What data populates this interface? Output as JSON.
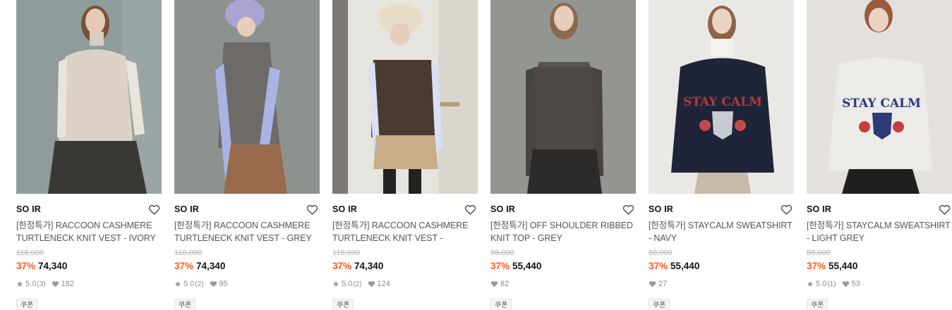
{
  "products": [
    {
      "brand": "SO IR",
      "title": "[한정특가] RACCOON CASHMERE TURTLENECK KNIT VEST - IVORY",
      "original_price": "118,000",
      "discount": "37%",
      "price": "74,340",
      "rating": "5.0",
      "review_count": "(3)",
      "likes": "182",
      "coupon": "쿠폰",
      "has_rating": true,
      "image_icon": "photo-model-ivory-knit-vest"
    },
    {
      "brand": "SO IR",
      "title": "[한정특가] RACCOON CASHMERE TURTLENECK KNIT VEST - GREY",
      "original_price": "118,000",
      "discount": "37%",
      "price": "74,340",
      "rating": "5.0",
      "review_count": "(2)",
      "likes": "95",
      "coupon": "쿠폰",
      "has_rating": true,
      "image_icon": "photo-model-grey-knit-vest"
    },
    {
      "brand": "SO IR",
      "title": "[한정특가] RACCOON CASHMERE TURTLENECK KNIT VEST - BROWN",
      "original_price": "118,000",
      "discount": "37%",
      "price": "74,340",
      "rating": "5.0",
      "review_count": "(2)",
      "likes": "124",
      "coupon": "쿠폰",
      "has_rating": true,
      "image_icon": "photo-model-brown-knit-vest"
    },
    {
      "brand": "SO IR",
      "title": "[한정특가] OFF SHOULDER RIBBED KNIT TOP - GREY",
      "original_price": "88,000",
      "discount": "37%",
      "price": "55,440",
      "rating": "",
      "review_count": "",
      "likes": "82",
      "coupon": "쿠폰",
      "has_rating": false,
      "image_icon": "photo-model-off-shoulder-knit"
    },
    {
      "brand": "SO IR",
      "title": "[한정특가] STAYCALM SWEATSHIRT - NAVY",
      "original_price": "88,000",
      "discount": "37%",
      "price": "55,440",
      "rating": "",
      "review_count": "",
      "likes": "27",
      "coupon": "쿠폰",
      "has_rating": false,
      "image_icon": "photo-model-navy-sweatshirt"
    },
    {
      "brand": "SO IR",
      "title": "[한정특가] STAYCALM SWEATSHIRT - LIGHT GREY",
      "original_price": "88,000",
      "discount": "37%",
      "price": "55,440",
      "rating": "5.0",
      "review_count": "(1)",
      "likes": "53",
      "coupon": "쿠폰",
      "has_rating": true,
      "image_icon": "photo-model-light-grey-sweatshirt"
    }
  ],
  "sweatshirt_print": "STAY CALM",
  "colors": {
    "discount": "#ff5a1f",
    "meta_icon": "#9a9a9a"
  }
}
